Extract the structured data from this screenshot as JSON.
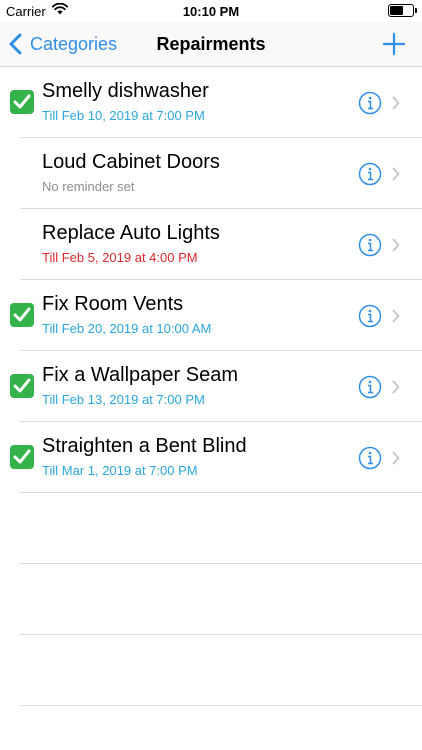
{
  "status_bar": {
    "carrier": "Carrier",
    "time": "10:10 PM",
    "battery_level": 0.6,
    "icons": [
      "wifi-icon",
      "battery-icon"
    ]
  },
  "nav": {
    "back_label": "Categories",
    "title": "Repairments",
    "icons": [
      "chevron-left-icon",
      "plus-icon"
    ]
  },
  "colors": {
    "accent": "#2f8ee8",
    "subtitle_blue": "#2aa7de",
    "subtitle_gray": "#8e8e93",
    "subtitle_red": "#e0282c",
    "check_green": "#33b34a"
  },
  "items": [
    {
      "title": "Smelly dishwasher",
      "subtitle": "Till Feb 10, 2019 at 7:00 PM",
      "done": true,
      "subtitle_color": "#2aa7de"
    },
    {
      "title": "Loud Cabinet Doors",
      "subtitle": "No reminder set",
      "done": false,
      "subtitle_color": "#8e8e93"
    },
    {
      "title": "Replace Auto Lights",
      "subtitle": "Till Feb 5, 2019 at 4:00 PM",
      "done": false,
      "subtitle_color": "#e0282c"
    },
    {
      "title": "Fix Room Vents",
      "subtitle": "Till Feb 20, 2019 at 10:00 AM",
      "done": true,
      "subtitle_color": "#2aa7de"
    },
    {
      "title": "Fix a Wallpaper Seam",
      "subtitle": "Till Feb 13, 2019 at 7:00 PM",
      "done": true,
      "subtitle_color": "#2aa7de"
    },
    {
      "title": "Straighten a Bent Blind",
      "subtitle": "Till Mar 1, 2019 at 7:00 PM",
      "done": true,
      "subtitle_color": "#2aa7de"
    }
  ]
}
